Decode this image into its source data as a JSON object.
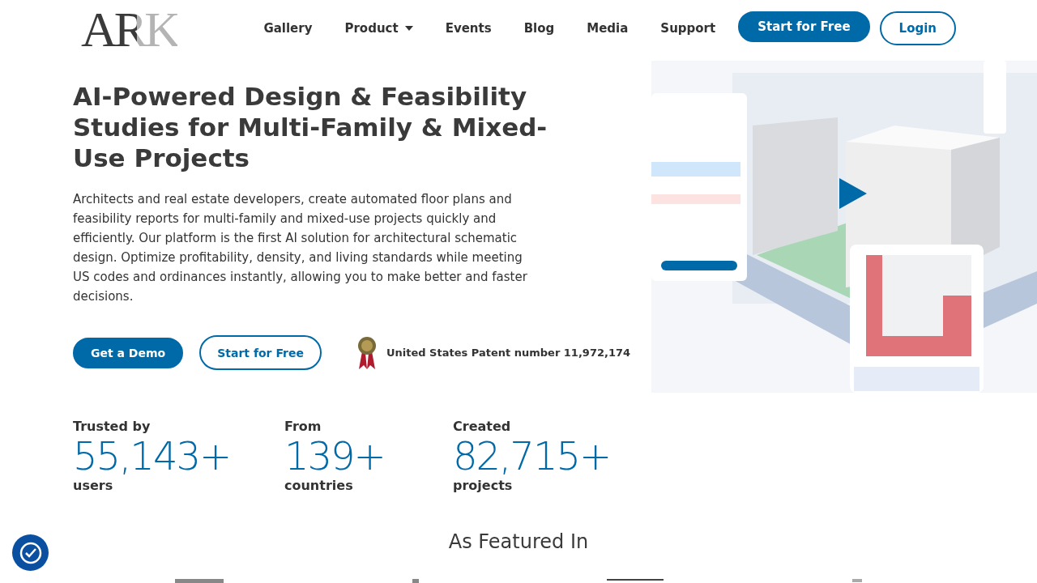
{
  "logo": {
    "text": "ARK"
  },
  "nav": {
    "items": [
      {
        "label": "Gallery",
        "kind": "link"
      },
      {
        "label": "Product",
        "kind": "dropdown"
      },
      {
        "label": "Events",
        "kind": "link"
      },
      {
        "label": "Blog",
        "kind": "link"
      },
      {
        "label": "Media",
        "kind": "link"
      },
      {
        "label": "Support",
        "kind": "link"
      }
    ],
    "buttons": [
      {
        "label": "Start for Free",
        "kind": "filled"
      },
      {
        "label": "Login",
        "kind": "outline"
      }
    ]
  },
  "hero": {
    "title": "AI-Powered Design & Feasibility Studies for Multi-Family & Mixed-Use Projects",
    "description": "Architects and real estate developers, create automated floor plans and feasibility reports for multi-family and mixed-use projects quickly and efficiently. Our platform is the first AI solution for architectural schematic design. Optimize profitability, density, and living standards while meeting US codes and ordinances instantly, allowing you to make better and faster decisions.",
    "buttons": [
      {
        "label": "Get a Demo",
        "kind": "filled"
      },
      {
        "label": "Start for Free",
        "kind": "outline"
      }
    ],
    "patent": "United States Patent number 11,972,174"
  },
  "stats": [
    {
      "label": "Trusted by",
      "value": "55,143+",
      "unit": "users"
    },
    {
      "label": "From",
      "value": "139+",
      "unit": "countries"
    },
    {
      "label": "Created",
      "value": "82,715+",
      "unit": "projects"
    }
  ],
  "featured": {
    "title": "As Featured In"
  }
}
